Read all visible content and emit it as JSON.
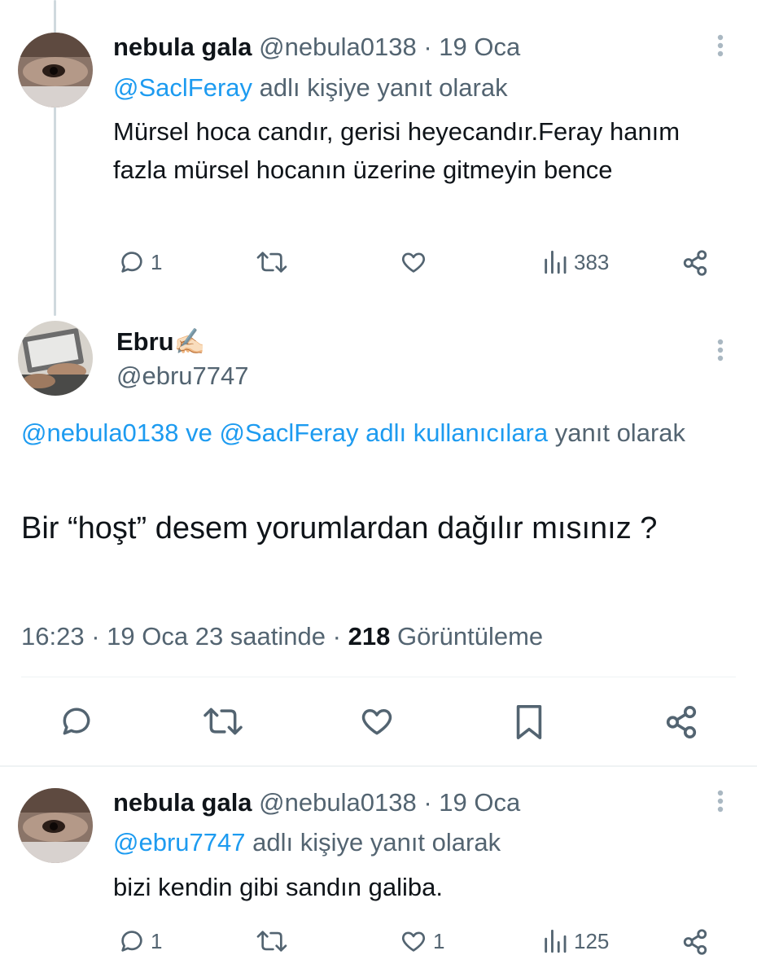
{
  "tweets": [
    {
      "name": "nebula gala",
      "handle": "@nebula0138",
      "sep": "·",
      "date": "19 Oca",
      "reply_link": "@SaclFeray",
      "reply_suffix": "adlı kişiye yanıt olarak",
      "text": "Mürsel hoca candır, gerisi heyecandır.Feray hanım fazla mürsel hocanın üzerine gitmeyin bence",
      "replies": "1",
      "retweets": "",
      "likes": "",
      "views": "383"
    }
  ],
  "main_tweet": {
    "name": "Ebru",
    "name_emoji": "✍🏻",
    "handle": "@ebru7747",
    "reply_links": "@nebula0138 ve @SaclFeray adlı kullanıcılara",
    "reply_suffix": "yanıt olarak",
    "text": "Bir “hoşt” desem yorumlardan dağılır mısınız ?",
    "time": "16:23",
    "sep": "·",
    "date_text": "19 Oca 23 saatinde",
    "views_count": "218",
    "views_label": "Görüntüleme"
  },
  "reply_tweet": {
    "name": "nebula gala",
    "handle": "@nebula0138",
    "sep": "·",
    "date": "19 Oca",
    "reply_link": "@ebru7747",
    "reply_suffix": "adlı kişiye yanıt olarak",
    "text": "bizi kendin gibi sandın galiba.",
    "replies": "1",
    "likes": "1",
    "views": "125"
  },
  "colors": {
    "accent": "#1d9bf0",
    "muted": "#536471",
    "text": "#0f1419",
    "thread_line": "#cfd9de"
  },
  "icons": [
    "reply-icon",
    "retweet-icon",
    "like-icon",
    "views-icon",
    "share-icon",
    "bookmark-icon",
    "more-icon"
  ]
}
